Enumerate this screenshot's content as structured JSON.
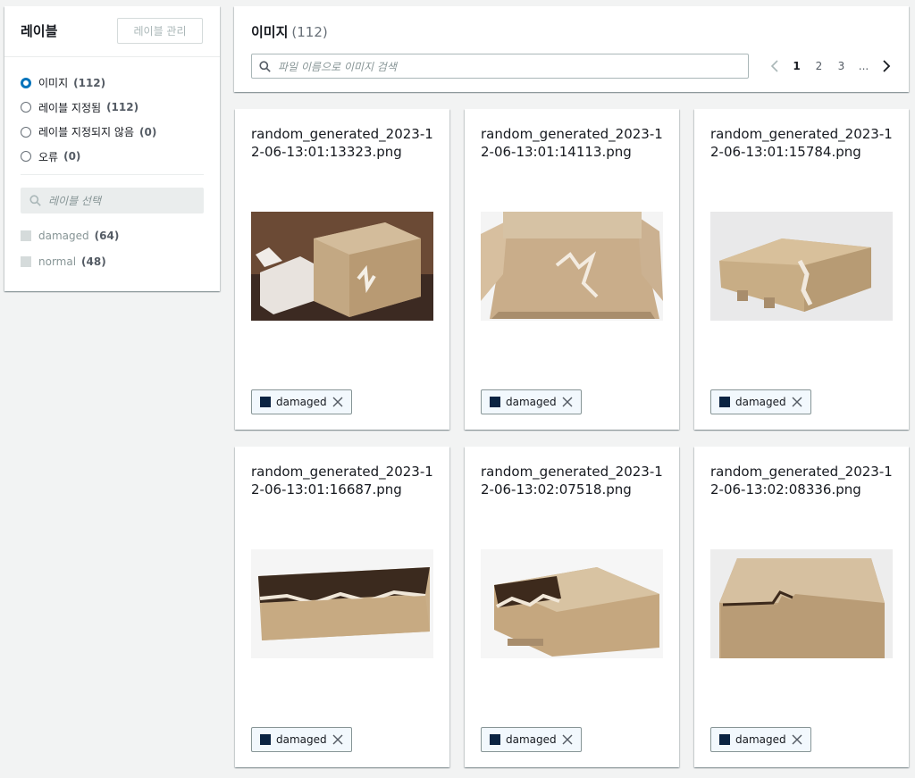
{
  "sidebar": {
    "title": "레이블",
    "manage_button": "레이블 관리",
    "filters": [
      {
        "label": "이미지",
        "count": "(112)",
        "checked": true
      },
      {
        "label": "레이블 지정됨",
        "count": "(112)",
        "checked": false
      },
      {
        "label": "레이블 지정되지 않음",
        "count": "(0)",
        "checked": false
      },
      {
        "label": "오류",
        "count": "(0)",
        "checked": false
      }
    ],
    "label_search_placeholder": "레이블 선택",
    "labels": [
      {
        "name": "damaged",
        "count": "(64)"
      },
      {
        "name": "normal",
        "count": "(48)"
      }
    ]
  },
  "header": {
    "title": "이미지",
    "count": "(112)",
    "search_placeholder": "파일 이름으로 이미지 검색",
    "pages": [
      "1",
      "2",
      "3",
      "..."
    ],
    "current_page": "1"
  },
  "colors": {
    "accent": "#0073bb",
    "tag_swatch": "#0a2342",
    "background": "#f2f3f3"
  },
  "cards": [
    {
      "filename": "random_generated_2023-12-06-13:01:13323.png",
      "tag": "damaged",
      "image": "photo-damaged-box-open-flap"
    },
    {
      "filename": "random_generated_2023-12-06-13:01:14113.png",
      "tag": "damaged",
      "image": "photo-open-box-torn-bottom"
    },
    {
      "filename": "random_generated_2023-12-06-13:01:15784.png",
      "tag": "damaged",
      "image": "photo-crushed-flat-box"
    },
    {
      "filename": "random_generated_2023-12-06-13:01:16687.png",
      "tag": "damaged",
      "image": "photo-long-box-torn-top"
    },
    {
      "filename": "random_generated_2023-12-06-13:02:07518.png",
      "tag": "damaged",
      "image": "photo-box-torn-end"
    },
    {
      "filename": "random_generated_2023-12-06-13:02:08336.png",
      "tag": "damaged",
      "image": "photo-box-torn-corner"
    }
  ]
}
